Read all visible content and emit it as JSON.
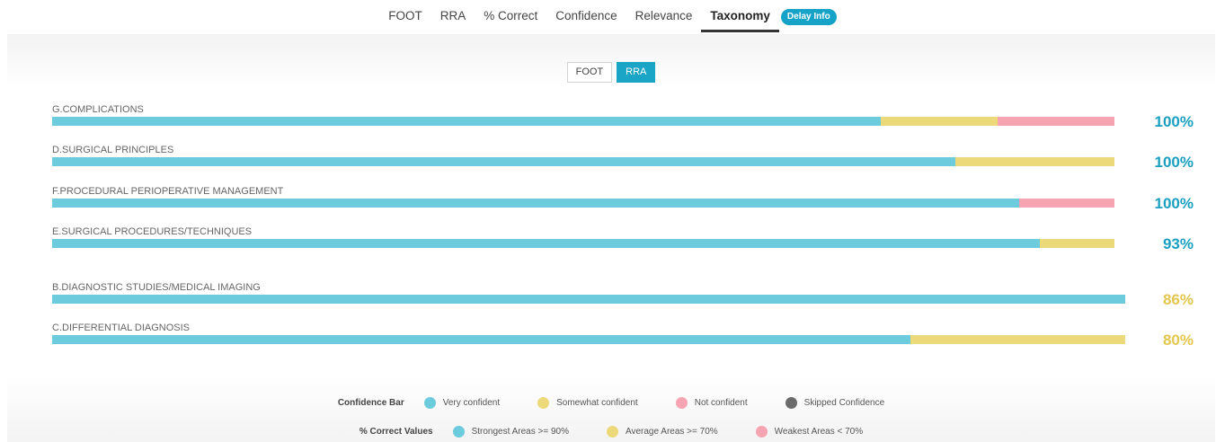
{
  "colors": {
    "very_confident": "#6ccbdc",
    "somewhat_confident": "#ecd97a",
    "not_confident": "#f6a3b2",
    "skipped": "#6b6b6b",
    "strongest": "#1a9fc0",
    "average": "#e3c64e",
    "weakest": "#f6a3b2",
    "accent": "#17a2c7"
  },
  "nav": {
    "tabs": [
      "FOOT",
      "RRA",
      "% Correct",
      "Confidence",
      "Relevance",
      "Taxonomy"
    ],
    "active_tab": "Taxonomy",
    "delay_button": "Delay Info"
  },
  "subtabs": {
    "items": [
      "FOOT",
      "RRA"
    ],
    "active": "RRA"
  },
  "categories": [
    {
      "label": "G.COMPLICATIONS",
      "percent": "100%",
      "tier": "strongest",
      "confidence": {
        "very": 0.78,
        "somewhat": 0.11,
        "not": 0.11
      },
      "bar_fraction": 0.99
    },
    {
      "label": "D.SURGICAL PRINCIPLES",
      "percent": "100%",
      "tier": "strongest",
      "confidence": {
        "very": 0.85,
        "somewhat": 0.15,
        "not": 0
      },
      "bar_fraction": 0.99
    },
    {
      "label": "F.PROCEDURAL PERIOPERATIVE MANAGEMENT",
      "percent": "100%",
      "tier": "strongest",
      "confidence": {
        "very": 0.91,
        "somewhat": 0,
        "not": 0.09
      },
      "bar_fraction": 0.99
    },
    {
      "label": "E.SURGICAL PROCEDURES/TECHNIQUES",
      "percent": "93%",
      "tier": "strongest",
      "confidence": {
        "very": 0.93,
        "somewhat": 0.07,
        "not": 0
      },
      "bar_fraction": 0.99
    },
    {
      "label": "B.DIAGNOSTIC STUDIES/MEDICAL IMAGING",
      "percent": "86%",
      "tier": "average",
      "confidence": {
        "very": 1.0,
        "somewhat": 0,
        "not": 0
      },
      "bar_fraction": 1.0
    },
    {
      "label": "C.DIFFERENTIAL DIAGNOSIS",
      "percent": "80%",
      "tier": "average",
      "confidence": {
        "very": 0.8,
        "somewhat": 0.2,
        "not": 0
      },
      "bar_fraction": 1.0
    }
  ],
  "legend": {
    "confidence_title": "Confidence Bar",
    "confidence_items": [
      {
        "label": "Very confident",
        "color_key": "very_confident"
      },
      {
        "label": "Somewhat confident",
        "color_key": "somewhat_confident"
      },
      {
        "label": "Not confident",
        "color_key": "not_confident"
      },
      {
        "label": "Skipped Confidence",
        "color_key": "skipped"
      }
    ],
    "correct_title": "% Correct Values",
    "correct_items": [
      {
        "label": "Strongest Areas >= 90%",
        "color_key": "very_confident"
      },
      {
        "label": "Average Areas >= 70%",
        "color_key": "somewhat_confident"
      },
      {
        "label": "Weakest Areas < 70%",
        "color_key": "not_confident"
      }
    ]
  }
}
